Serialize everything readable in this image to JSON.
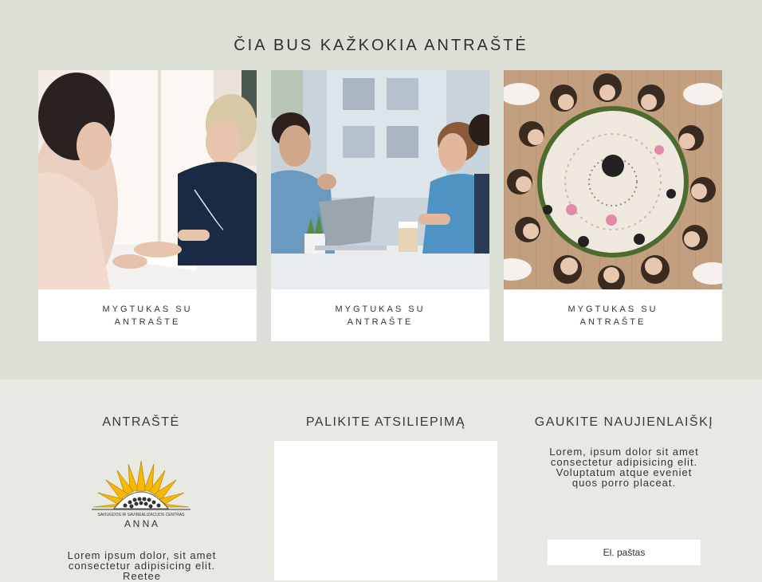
{
  "gallery": {
    "title": "ČIA BUS KAŽKOKIA ANTRAŠTĖ",
    "cards": [
      {
        "image": "two-women-meeting-photo",
        "button": "MYGTUKAS SU ANTRAŠTE"
      },
      {
        "image": "office-team-meeting-photo",
        "button": "MYGTUKAS SU ANTRAŠTE"
      },
      {
        "image": "women-circle-mandala-photo",
        "button": "MYGTUKAS SU ANTRAŠTE"
      }
    ]
  },
  "footer": {
    "col1": {
      "title": "ANTRAŠTĖ",
      "logo_tagline": "SAVIUGDOS IR SAVIREALIZACIJOS CENTRAS",
      "logo_name": "A N N A",
      "text": "Lorem ipsum dolor, sit amet consectetur adipisicing elit. Reetee"
    },
    "col2": {
      "title": "PALIKITE ATSILIEPIMĄ"
    },
    "col3": {
      "title": "GAUKITE NAUJIENLAIŠKĮ",
      "text": "Lorem, ipsum dolor sit amet consectetur adipisicing elit. Voluptatum atque eveniet quos porro placeat.",
      "email_placeholder": "El. paštas"
    }
  },
  "colors": {
    "top_bg": "#dcdfd5",
    "bottom_bg": "#e8e9e3",
    "logo_yellow": "#f6b800"
  }
}
